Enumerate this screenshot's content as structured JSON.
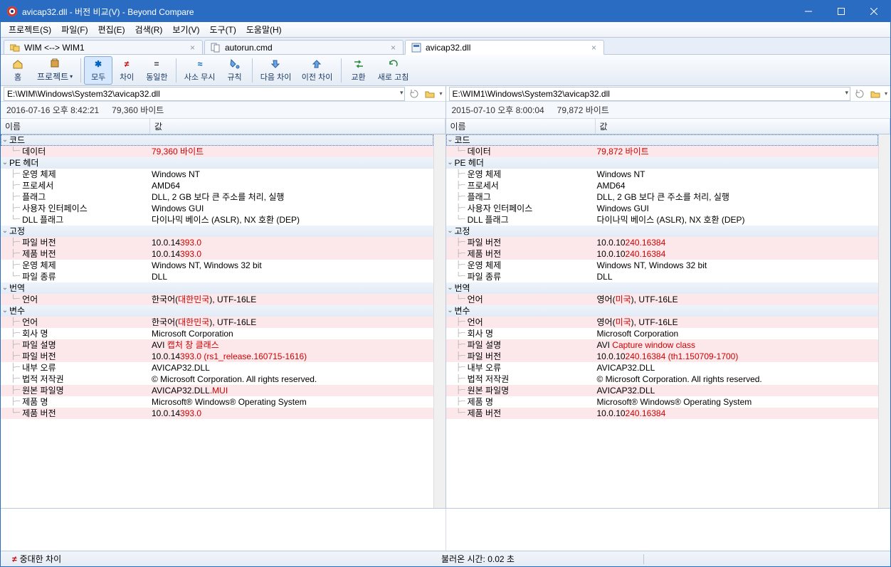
{
  "window": {
    "title": "avicap32.dll - 버전 비교(V) - Beyond Compare"
  },
  "menu": {
    "project": "프로젝트(S)",
    "file": "파일(F)",
    "edit": "편집(E)",
    "search": "검색(R)",
    "view": "보기(V)",
    "tools": "도구(T)",
    "help": "도움말(H)"
  },
  "tabs": {
    "t0": "WIM <--> WIM1",
    "t1": "autorun.cmd",
    "t2": "avicap32.dll"
  },
  "toolbar": {
    "home": "홈",
    "project": "프로젝트",
    "all": "모두",
    "diff": "차이",
    "same": "동일한",
    "minor": "사소 무시",
    "rules": "규칙",
    "nextdiff": "다음 차이",
    "prevdiff": "이전 차이",
    "swap": "교환",
    "refresh": "새로 고침"
  },
  "left": {
    "path": "E:\\WIM\\Windows\\System32\\avicap32.dll",
    "date": "2016-07-16 오후 8:42:21",
    "size": "79,360 바이트"
  },
  "right": {
    "path": "E:\\WIM1\\Windows\\System32\\avicap32.dll",
    "date": "2015-07-10 오후 8:00:04",
    "size": "79,872 바이트"
  },
  "cols": {
    "name": "이름",
    "value": "값"
  },
  "groups": {
    "code": "코드",
    "peheader": "PE 헤더",
    "fixed": "고정",
    "translation": "번역",
    "variable": "변수"
  },
  "labels": {
    "data": "데이터",
    "os": "운영 체제",
    "processor": "프로세서",
    "flags": "플래그",
    "ui": "사용자 인터페이스",
    "dllflags": "DLL 플래그",
    "filever": "파일 버전",
    "prodver": "제품 버전",
    "filetype": "파일 종류",
    "lang": "언어",
    "language": "언어",
    "company": "회사 명",
    "filedesc": "파일 설명",
    "internal": "내부 오류",
    "copyright": "법적 저작권",
    "origname": "원본 파일명",
    "prodname": "제품 명"
  },
  "common": {
    "winnt": "Windows NT",
    "amd64": "AMD64",
    "flags_v": "DLL, 2 GB 보다 큰 주소를 처리, 실행",
    "gui": "Windows GUI",
    "dllflags_v": "다이나믹 베이스 (ASLR), NX 호환 (DEP)",
    "os2": "Windows NT, Windows 32 bit",
    "filetype_v": "DLL",
    "company_v": "Microsoft Corporation",
    "internal_v": "AVICAP32.DLL",
    "copyright_v": "© Microsoft Corporation. All rights reserved.",
    "prodname_v": "Microsoft® Windows® Operating System"
  },
  "L": {
    "data_v": "79,360 바이트",
    "filever_pre": "10.0.14",
    "filever_red": "393.0",
    "prodver_pre": "10.0.14",
    "prodver_red": "393.0",
    "lang_pre": "한국어(",
    "lang_red": "대한민국",
    "lang_post": "), UTF-16LE",
    "vlang_pre": "한국어(",
    "vlang_red": "대한민국",
    "vlang_post": "), UTF-16LE",
    "filedesc_pre": "AVI ",
    "filedesc_red": "캡처 창 클래스",
    "filedesc_post": "",
    "fv2_pre": "10.0.14",
    "fv2_red": "393.0 (rs1_release.160715-1616)",
    "fv2_post": "",
    "orig_pre": "AVICAP32.DLL",
    "orig_red": ".MUI",
    "pv2_pre": "10.0.14",
    "pv2_red": "393.0"
  },
  "R": {
    "data_v": "79,872 바이트",
    "filever_pre": "10.0.10",
    "filever_red": "240.16384",
    "prodver_pre": "10.0.10",
    "prodver_red": "240.16384",
    "lang_pre": "영어(",
    "lang_red": "미국",
    "lang_post": "), UTF-16LE",
    "vlang_pre": "영어(",
    "vlang_red": "미국",
    "vlang_post": "), UTF-16LE",
    "filedesc_pre": "AVI ",
    "filedesc_red": "Capture window class",
    "filedesc_post": "",
    "fv2_pre": "10.0.10",
    "fv2_red": "240.16384 (th1.150709-1700)",
    "fv2_post": "",
    "orig_pre": "AVICAP32.DLL",
    "orig_red": "",
    "pv2_pre": "10.0.10",
    "pv2_red": "240.16384"
  },
  "status": {
    "diff": "중대한 차이",
    "loadtime": "불러온 시간: 0.02 초"
  }
}
